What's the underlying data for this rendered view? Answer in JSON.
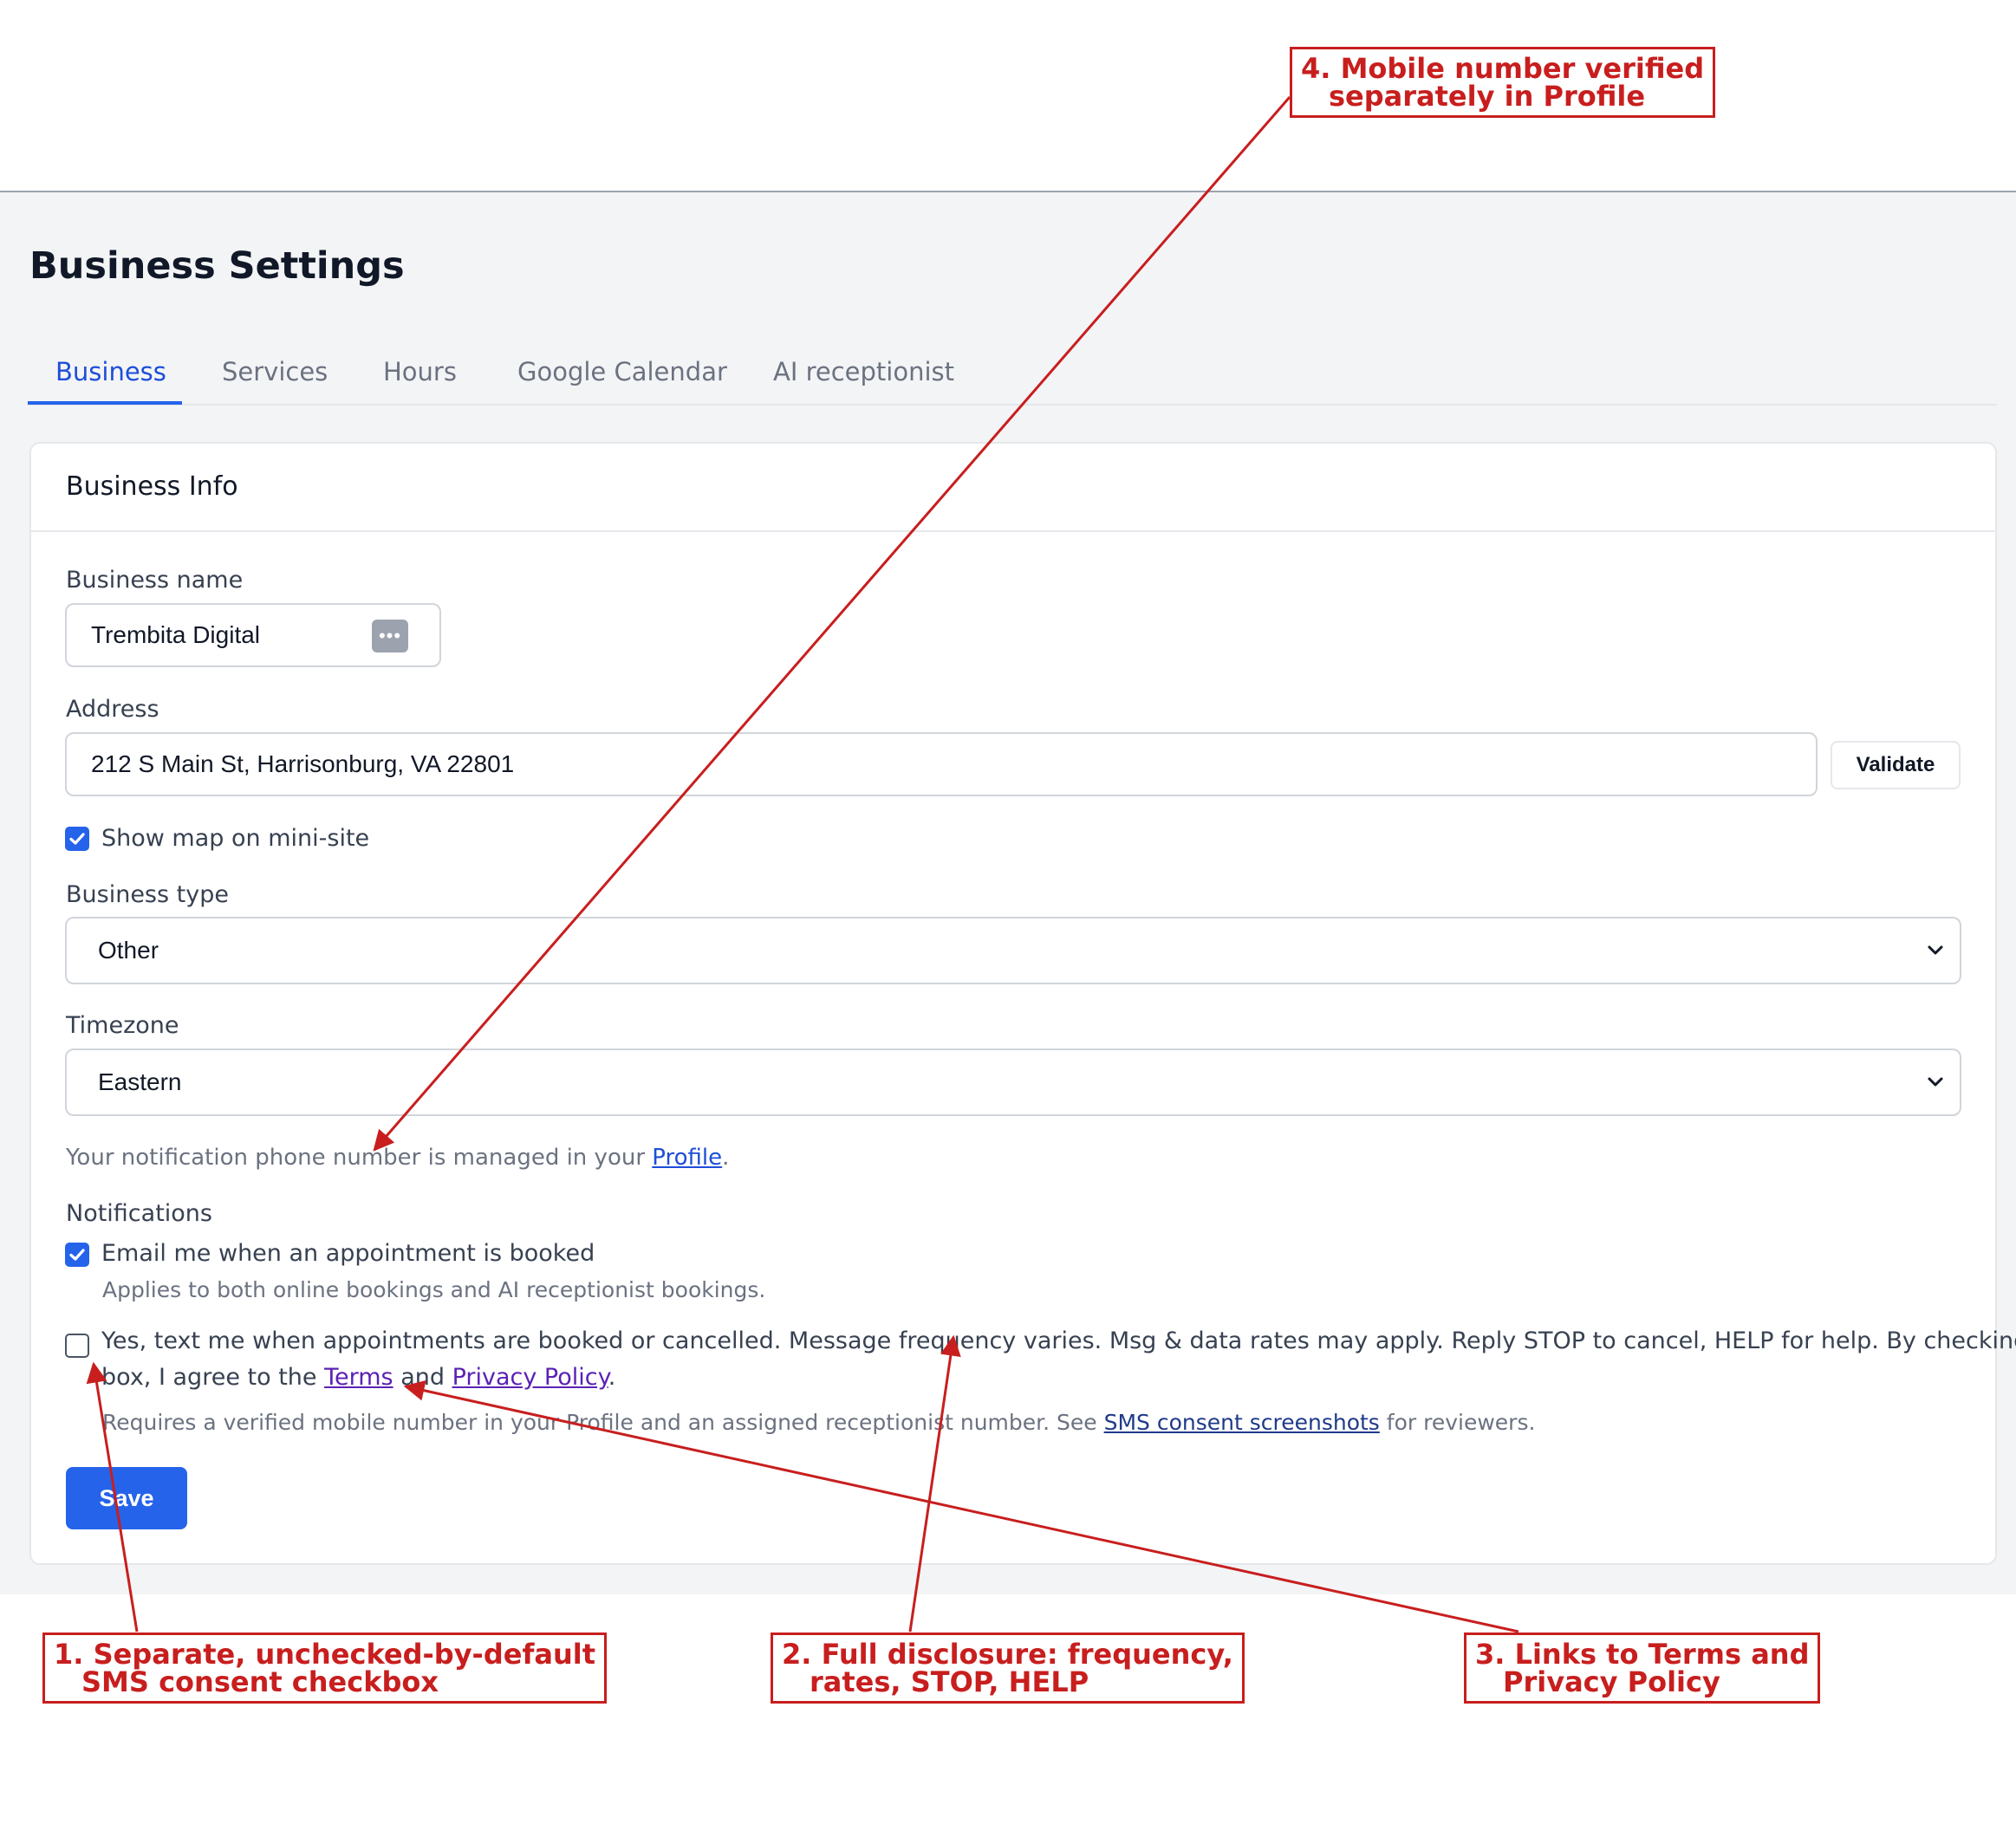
{
  "page": {
    "title": "Business Settings"
  },
  "tabs": [
    {
      "label": "Business",
      "active": true
    },
    {
      "label": "Services"
    },
    {
      "label": "Hours"
    },
    {
      "label": "Google Calendar"
    },
    {
      "label": "AI receptionist"
    }
  ],
  "card": {
    "title": "Business Info"
  },
  "form": {
    "business_name": {
      "label": "Business name",
      "value": "Trembita Digital",
      "icon": "more-dots-icon"
    },
    "address": {
      "label": "Address",
      "value": "212 S Main St, Harrisonburg, VA 22801",
      "validate_label": "Validate"
    },
    "show_map": {
      "label": "Show map on mini-site",
      "checked": true
    },
    "business_type": {
      "label": "Business type",
      "selected": "Other"
    },
    "timezone": {
      "label": "Timezone",
      "selected": "Eastern"
    },
    "phone_note": {
      "prefix": "Your notification phone number is managed in your ",
      "link": "Profile",
      "suffix": "."
    },
    "notifications": {
      "heading": "Notifications",
      "email": {
        "label": "Email me when an appointment is booked",
        "hint": "Applies to both online bookings and AI receptionist bookings.",
        "checked": true
      },
      "sms": {
        "checked": false,
        "line1": "Yes, text me when appointments are booked or cancelled. Message frequency varies. Msg & data rates may apply. Reply STOP to cancel, HELP for help. By checking this",
        "line2_prefix": "box, I agree to the ",
        "terms": "Terms",
        "and": " and ",
        "privacy": "Privacy Policy",
        "line2_suffix": ".",
        "hint_prefix": "Requires a verified mobile number in your Profile and an assigned receptionist number. See ",
        "hint_link": "SMS consent screenshots",
        "hint_suffix": " for reviewers."
      }
    },
    "save_label": "Save"
  },
  "annotations": {
    "note1": [
      "1. Separate, unchecked-by-default",
      "SMS consent checkbox"
    ],
    "note2": [
      "2. Full disclosure: frequency,",
      "rates, STOP, HELP"
    ],
    "note3": [
      "3. Links to Terms and",
      "Privacy Policy"
    ],
    "note4": [
      "4. Mobile number verified",
      "separately in Profile"
    ],
    "color": "#c81e1e"
  },
  "colors": {
    "accent": "#2563eb",
    "background": "#f3f4f6",
    "annotation": "#c81e1e"
  }
}
